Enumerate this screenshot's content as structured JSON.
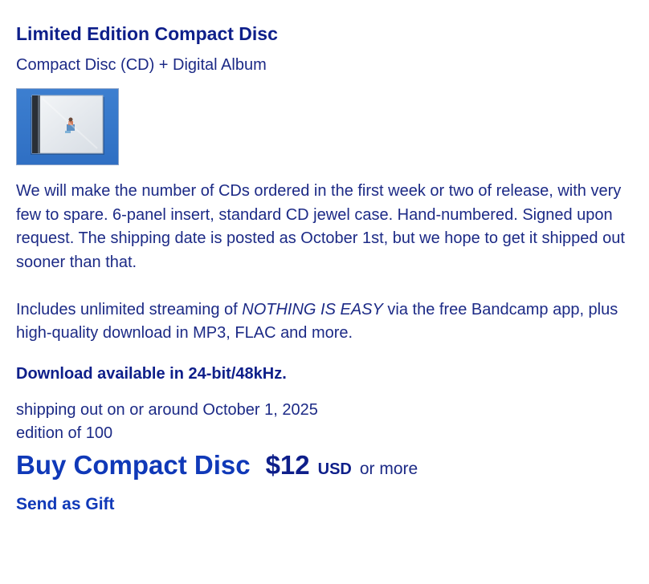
{
  "package": {
    "title": "Limited Edition Compact Disc",
    "format": "Compact Disc (CD) + Digital Album",
    "image_icon": "cd-jewel-case-icon",
    "description": {
      "p1": "We will make the number of CDs ordered in the first week or two of release, with very few to spare. 6-panel insert, standard CD jewel case. Hand-numbered. Signed upon request. The shipping date is posted as October 1st, but we hope to get it shipped out sooner than that.",
      "p2_before": "Includes unlimited streaming of ",
      "p2_album": "NOTHING IS EASY",
      "p2_after": " via the free Bandcamp app, plus high-quality download in MP3, FLAC and more."
    },
    "hires_note": "Download available in 24-bit/48kHz.",
    "shipping": "shipping out on or around October 1, 2025",
    "edition": "edition of 100"
  },
  "purchase": {
    "buy_label": "Buy Compact Disc",
    "price": "$12",
    "currency": "USD",
    "or_more": "or more",
    "gift_label": "Send as Gift"
  },
  "colors": {
    "link": "#1039b8",
    "text": "#1c2a86",
    "heading": "#0e1f8a"
  }
}
